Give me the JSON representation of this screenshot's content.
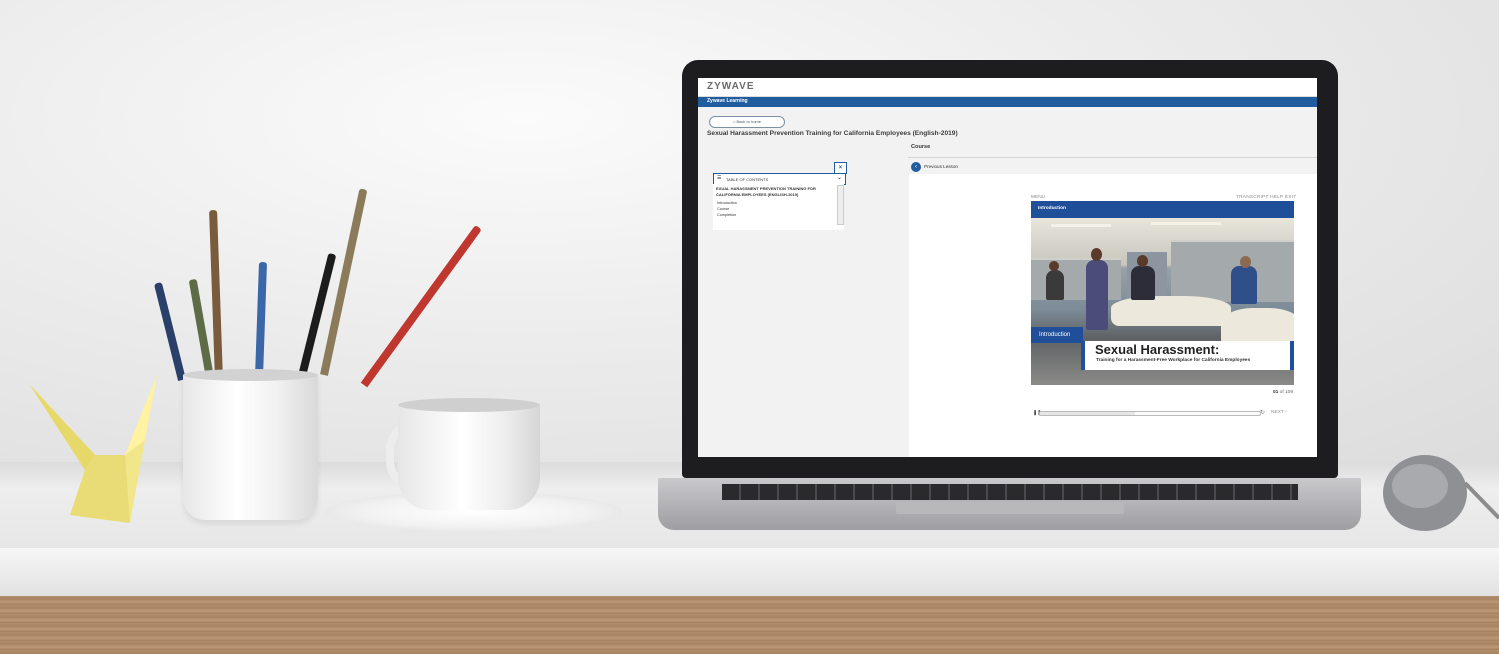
{
  "app": {
    "logo_text": "ZYWAVE",
    "nav_title": "Zywave Learning",
    "back_button": "Back to home",
    "course_title": "Sexual Harassment Prevention Training for California Employees (English-2019)",
    "section_label": "Course",
    "previous_lesson": "Previous Lesson"
  },
  "toc": {
    "close_icon": "×",
    "header_label": "TABLE OF CONTENTS",
    "heading": "EXUAL HARASSMENT PREVENTION TRAINING FOR CALIFORNIA EMPLOYEES (ENGLISH-2019)",
    "items": [
      "Introduction",
      "Course",
      "Completion"
    ]
  },
  "player": {
    "menu_label": "MENU",
    "top_right": "TRANSCRIPT  HELP  EXIT",
    "slide_bar_title": "Introduction",
    "intro_tag": "Introduction",
    "slide_title": "Sexual Harassment:",
    "slide_subtitle": "Training for a Harassment-Free Workplace for California Employees",
    "page_current": "01",
    "page_rest": " of 109",
    "progress_fraction": 0.43,
    "next_label": "NEXT ›"
  },
  "icons": {
    "home": "home-icon",
    "pause": "pause-icon",
    "restart": "restart-icon",
    "chevron": "chevron-down-icon",
    "menu": "list-icon",
    "prev": "chevron-left-icon"
  },
  "colors": {
    "brand_blue": "#1f5d9e",
    "slide_blue": "#1f4f99"
  }
}
